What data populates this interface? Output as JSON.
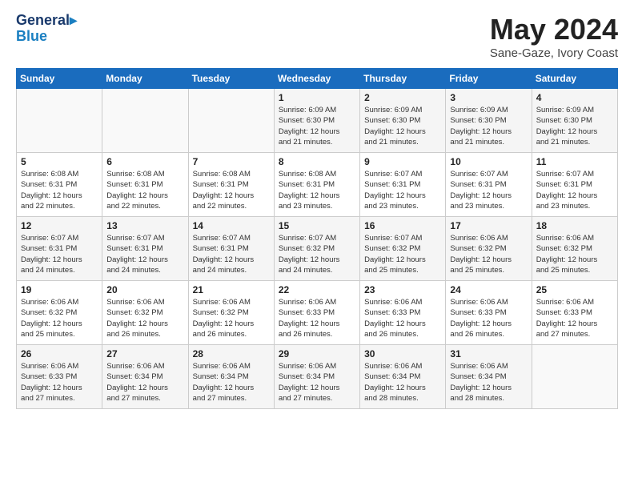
{
  "header": {
    "logo_line1": "General",
    "logo_line2": "Blue",
    "month": "May 2024",
    "location": "Sane-Gaze, Ivory Coast"
  },
  "weekdays": [
    "Sunday",
    "Monday",
    "Tuesday",
    "Wednesday",
    "Thursday",
    "Friday",
    "Saturday"
  ],
  "weeks": [
    [
      {
        "day": "",
        "info": ""
      },
      {
        "day": "",
        "info": ""
      },
      {
        "day": "",
        "info": ""
      },
      {
        "day": "1",
        "info": "Sunrise: 6:09 AM\nSunset: 6:30 PM\nDaylight: 12 hours\nand 21 minutes."
      },
      {
        "day": "2",
        "info": "Sunrise: 6:09 AM\nSunset: 6:30 PM\nDaylight: 12 hours\nand 21 minutes."
      },
      {
        "day": "3",
        "info": "Sunrise: 6:09 AM\nSunset: 6:30 PM\nDaylight: 12 hours\nand 21 minutes."
      },
      {
        "day": "4",
        "info": "Sunrise: 6:09 AM\nSunset: 6:30 PM\nDaylight: 12 hours\nand 21 minutes."
      }
    ],
    [
      {
        "day": "5",
        "info": "Sunrise: 6:08 AM\nSunset: 6:31 PM\nDaylight: 12 hours\nand 22 minutes."
      },
      {
        "day": "6",
        "info": "Sunrise: 6:08 AM\nSunset: 6:31 PM\nDaylight: 12 hours\nand 22 minutes."
      },
      {
        "day": "7",
        "info": "Sunrise: 6:08 AM\nSunset: 6:31 PM\nDaylight: 12 hours\nand 22 minutes."
      },
      {
        "day": "8",
        "info": "Sunrise: 6:08 AM\nSunset: 6:31 PM\nDaylight: 12 hours\nand 23 minutes."
      },
      {
        "day": "9",
        "info": "Sunrise: 6:07 AM\nSunset: 6:31 PM\nDaylight: 12 hours\nand 23 minutes."
      },
      {
        "day": "10",
        "info": "Sunrise: 6:07 AM\nSunset: 6:31 PM\nDaylight: 12 hours\nand 23 minutes."
      },
      {
        "day": "11",
        "info": "Sunrise: 6:07 AM\nSunset: 6:31 PM\nDaylight: 12 hours\nand 23 minutes."
      }
    ],
    [
      {
        "day": "12",
        "info": "Sunrise: 6:07 AM\nSunset: 6:31 PM\nDaylight: 12 hours\nand 24 minutes."
      },
      {
        "day": "13",
        "info": "Sunrise: 6:07 AM\nSunset: 6:31 PM\nDaylight: 12 hours\nand 24 minutes."
      },
      {
        "day": "14",
        "info": "Sunrise: 6:07 AM\nSunset: 6:31 PM\nDaylight: 12 hours\nand 24 minutes."
      },
      {
        "day": "15",
        "info": "Sunrise: 6:07 AM\nSunset: 6:32 PM\nDaylight: 12 hours\nand 24 minutes."
      },
      {
        "day": "16",
        "info": "Sunrise: 6:07 AM\nSunset: 6:32 PM\nDaylight: 12 hours\nand 25 minutes."
      },
      {
        "day": "17",
        "info": "Sunrise: 6:06 AM\nSunset: 6:32 PM\nDaylight: 12 hours\nand 25 minutes."
      },
      {
        "day": "18",
        "info": "Sunrise: 6:06 AM\nSunset: 6:32 PM\nDaylight: 12 hours\nand 25 minutes."
      }
    ],
    [
      {
        "day": "19",
        "info": "Sunrise: 6:06 AM\nSunset: 6:32 PM\nDaylight: 12 hours\nand 25 minutes."
      },
      {
        "day": "20",
        "info": "Sunrise: 6:06 AM\nSunset: 6:32 PM\nDaylight: 12 hours\nand 26 minutes."
      },
      {
        "day": "21",
        "info": "Sunrise: 6:06 AM\nSunset: 6:32 PM\nDaylight: 12 hours\nand 26 minutes."
      },
      {
        "day": "22",
        "info": "Sunrise: 6:06 AM\nSunset: 6:33 PM\nDaylight: 12 hours\nand 26 minutes."
      },
      {
        "day": "23",
        "info": "Sunrise: 6:06 AM\nSunset: 6:33 PM\nDaylight: 12 hours\nand 26 minutes."
      },
      {
        "day": "24",
        "info": "Sunrise: 6:06 AM\nSunset: 6:33 PM\nDaylight: 12 hours\nand 26 minutes."
      },
      {
        "day": "25",
        "info": "Sunrise: 6:06 AM\nSunset: 6:33 PM\nDaylight: 12 hours\nand 27 minutes."
      }
    ],
    [
      {
        "day": "26",
        "info": "Sunrise: 6:06 AM\nSunset: 6:33 PM\nDaylight: 12 hours\nand 27 minutes."
      },
      {
        "day": "27",
        "info": "Sunrise: 6:06 AM\nSunset: 6:34 PM\nDaylight: 12 hours\nand 27 minutes."
      },
      {
        "day": "28",
        "info": "Sunrise: 6:06 AM\nSunset: 6:34 PM\nDaylight: 12 hours\nand 27 minutes."
      },
      {
        "day": "29",
        "info": "Sunrise: 6:06 AM\nSunset: 6:34 PM\nDaylight: 12 hours\nand 27 minutes."
      },
      {
        "day": "30",
        "info": "Sunrise: 6:06 AM\nSunset: 6:34 PM\nDaylight: 12 hours\nand 28 minutes."
      },
      {
        "day": "31",
        "info": "Sunrise: 6:06 AM\nSunset: 6:34 PM\nDaylight: 12 hours\nand 28 minutes."
      },
      {
        "day": "",
        "info": ""
      }
    ]
  ]
}
